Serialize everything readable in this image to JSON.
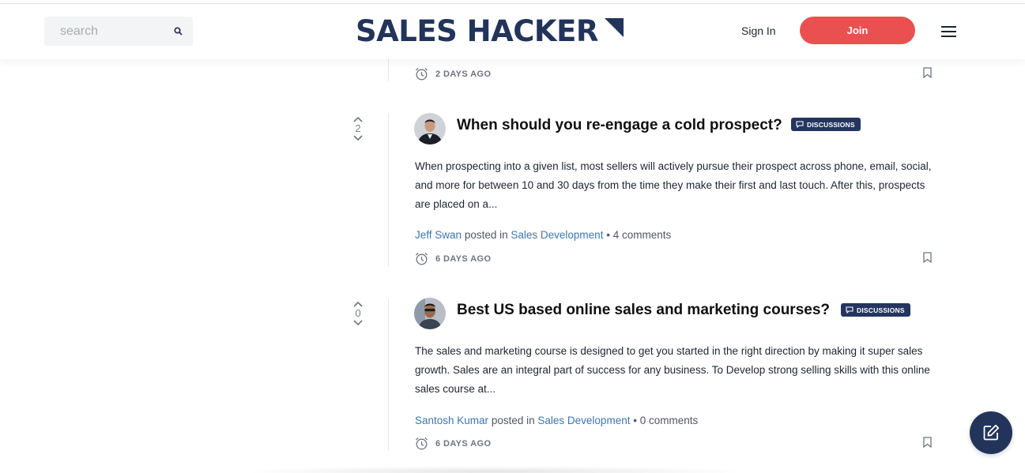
{
  "header": {
    "search_placeholder": "search",
    "logo_text": "SALES HACKER",
    "signin_label": "Sign In",
    "join_label": "Join"
  },
  "previous_post": {
    "time": "2 DAYS AGO"
  },
  "posts": [
    {
      "votes": "2",
      "title": "When should you re-engage a cold prospect?",
      "badge": "DISCUSSIONS",
      "excerpt": "When prospecting into a given list, most sellers will actively pursue their prospect across phone, email, social, and more for between 10 and 30 days from the time they make their first and last touch. After this, prospects are placed on a...",
      "author": "Jeff Swan",
      "posted_in": "posted in",
      "category": "Sales Development",
      "separator": " • ",
      "comments": "4 comments",
      "time": "6 DAYS AGO"
    },
    {
      "votes": "0",
      "title": "Best US based online sales and marketing courses?",
      "badge": "DISCUSSIONS",
      "excerpt": "The sales and marketing course is designed to get you started in the right direction by making it super sales growth. Sales are an integral part of success for any business. To Develop strong selling skills with this online sales course at...",
      "author": "Santosh Kumar",
      "posted_in": "posted in",
      "category": "Sales Development",
      "separator": " • ",
      "comments": "0 comments",
      "time": "6 DAYS AGO"
    }
  ],
  "colors": {
    "brand_navy": "#22345a",
    "join_red": "#eb5050",
    "link_blue": "#3d77b0"
  },
  "icons": {
    "search": "search-icon",
    "logo": "logo-corner-mark",
    "menu": "hamburger-menu-icon",
    "clock": "alarm-clock-icon",
    "bookmark": "bookmark-icon",
    "upvote": "chevron-up-icon",
    "downvote": "chevron-down-icon",
    "fab": "edit-icon"
  }
}
